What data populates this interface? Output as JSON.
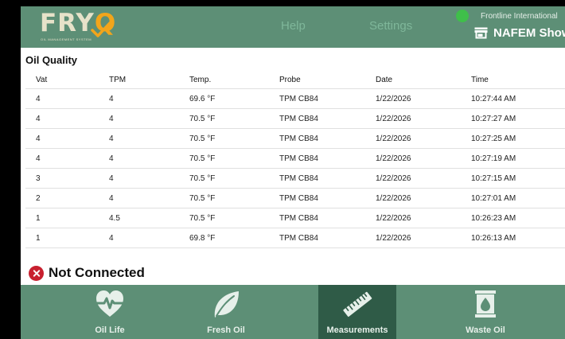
{
  "header": {
    "logo_text": "FRY",
    "logo_letter": "Q",
    "logo_tagline": "OIL MANAGEMENT SYSTEM",
    "help_label": "Help",
    "settings_label": "Settings",
    "organization": "Frontline International",
    "store_name": "NAFEM Show",
    "colors": {
      "bar": "#5d8f76",
      "accent": "#f2a51b",
      "status": "#3fbf4a"
    }
  },
  "oil_quality": {
    "title": "Oil Quality",
    "columns": [
      "Vat",
      "TPM",
      "Temp.",
      "Probe",
      "Date",
      "Time"
    ],
    "rows": [
      [
        "4",
        "4",
        "69.6 °F",
        "TPM CB84",
        "1/22/2026",
        "10:27:44 AM"
      ],
      [
        "4",
        "4",
        "70.5 °F",
        "TPM CB84",
        "1/22/2026",
        "10:27:27 AM"
      ],
      [
        "4",
        "4",
        "70.5 °F",
        "TPM CB84",
        "1/22/2026",
        "10:27:25 AM"
      ],
      [
        "4",
        "4",
        "70.5 °F",
        "TPM CB84",
        "1/22/2026",
        "10:27:19 AM"
      ],
      [
        "3",
        "4",
        "70.5 °F",
        "TPM CB84",
        "1/22/2026",
        "10:27:15 AM"
      ],
      [
        "2",
        "4",
        "70.5 °F",
        "TPM CB84",
        "1/22/2026",
        "10:27:01 AM"
      ],
      [
        "1",
        "4.5",
        "70.5 °F",
        "TPM CB84",
        "1/22/2026",
        "10:26:23 AM"
      ],
      [
        "1",
        "4",
        "69.8 °F",
        "TPM CB84",
        "1/22/2026",
        "10:26:13 AM"
      ]
    ]
  },
  "connection": {
    "status_text": "Not Connected",
    "icon": "error-x-icon",
    "color": "#c8202f"
  },
  "bottom_nav": {
    "tabs": [
      {
        "label": "Oil Life",
        "icon": "heartbeat-icon",
        "active": false
      },
      {
        "label": "Fresh Oil",
        "icon": "leaf-icon",
        "active": false
      },
      {
        "label": "Measurements",
        "icon": "ruler-icon",
        "active": true
      },
      {
        "label": "Waste Oil",
        "icon": "oil-drum-icon",
        "active": false
      }
    ]
  }
}
